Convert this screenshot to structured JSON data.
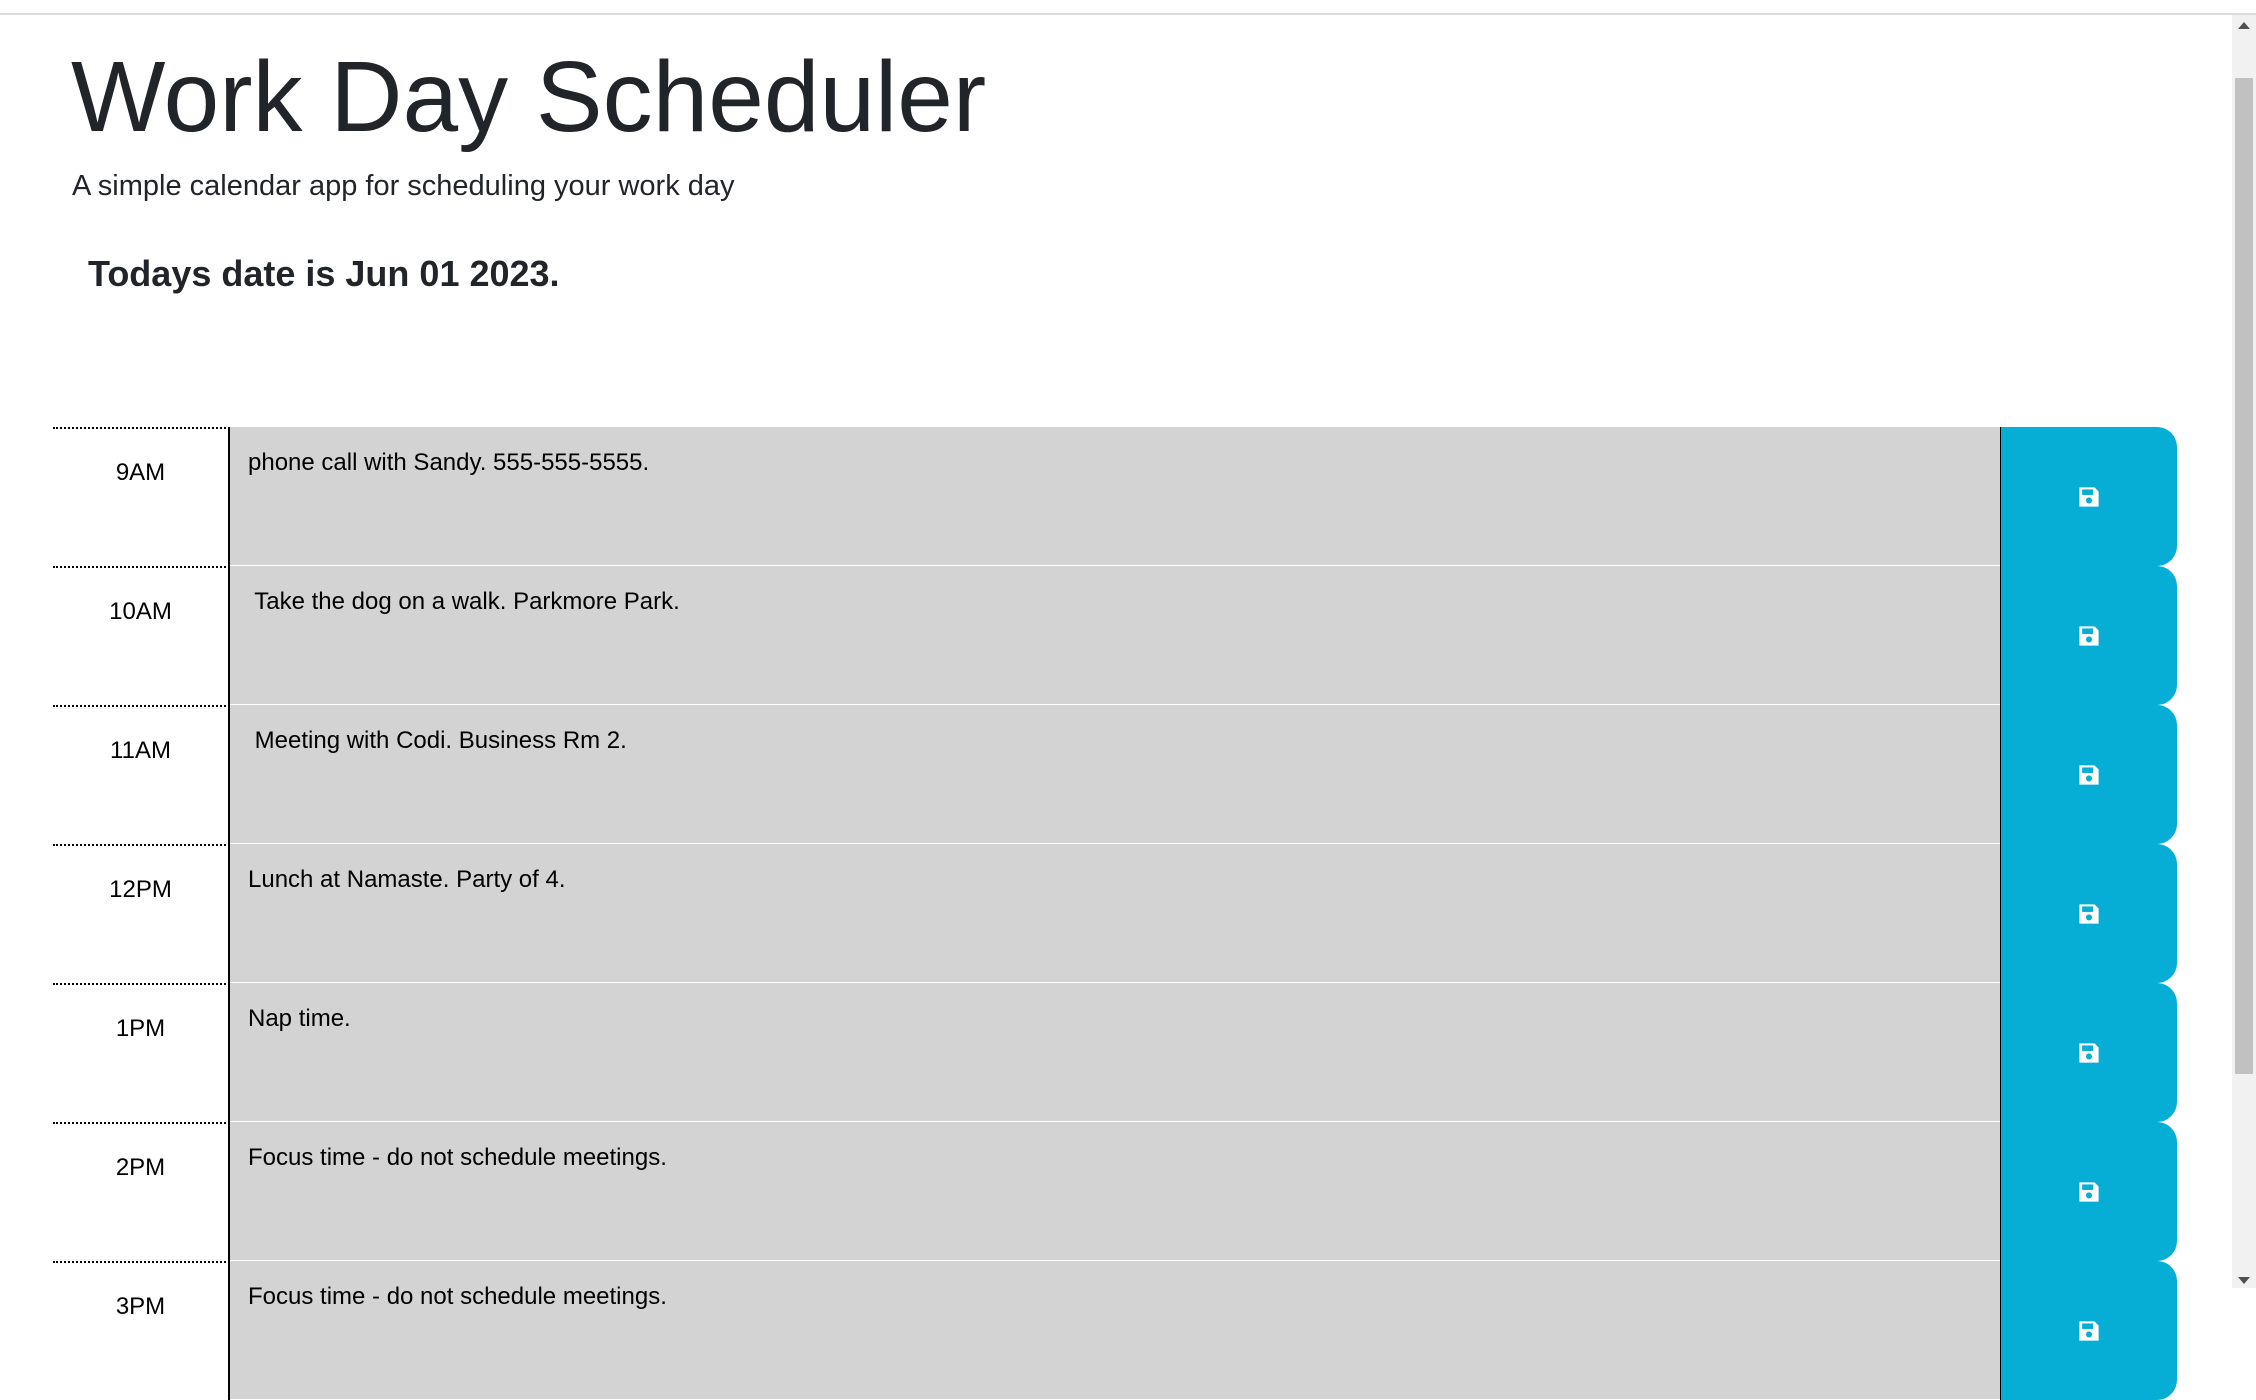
{
  "header": {
    "title": "Work Day Scheduler",
    "subtitle": "A simple calendar app for scheduling your work day",
    "today": "Todays date is Jun 01 2023."
  },
  "rows": [
    {
      "hour": "9AM",
      "text": "phone call with Sandy. 555-555-5555."
    },
    {
      "hour": "10AM",
      "text": " Take the dog on a walk. Parkmore Park."
    },
    {
      "hour": "11AM",
      "text": " Meeting with Codi. Business Rm 2."
    },
    {
      "hour": "12PM",
      "text": "Lunch at Namaste. Party of 4."
    },
    {
      "hour": "1PM",
      "text": "Nap time."
    },
    {
      "hour": "2PM",
      "text": "Focus time - do not schedule meetings."
    },
    {
      "hour": "3PM",
      "text": "Focus time - do not schedule meetings."
    }
  ],
  "icons": {
    "save": "save-icon"
  },
  "colors": {
    "save_button": "#06aed5",
    "description_bg": "#d3d3d3"
  }
}
